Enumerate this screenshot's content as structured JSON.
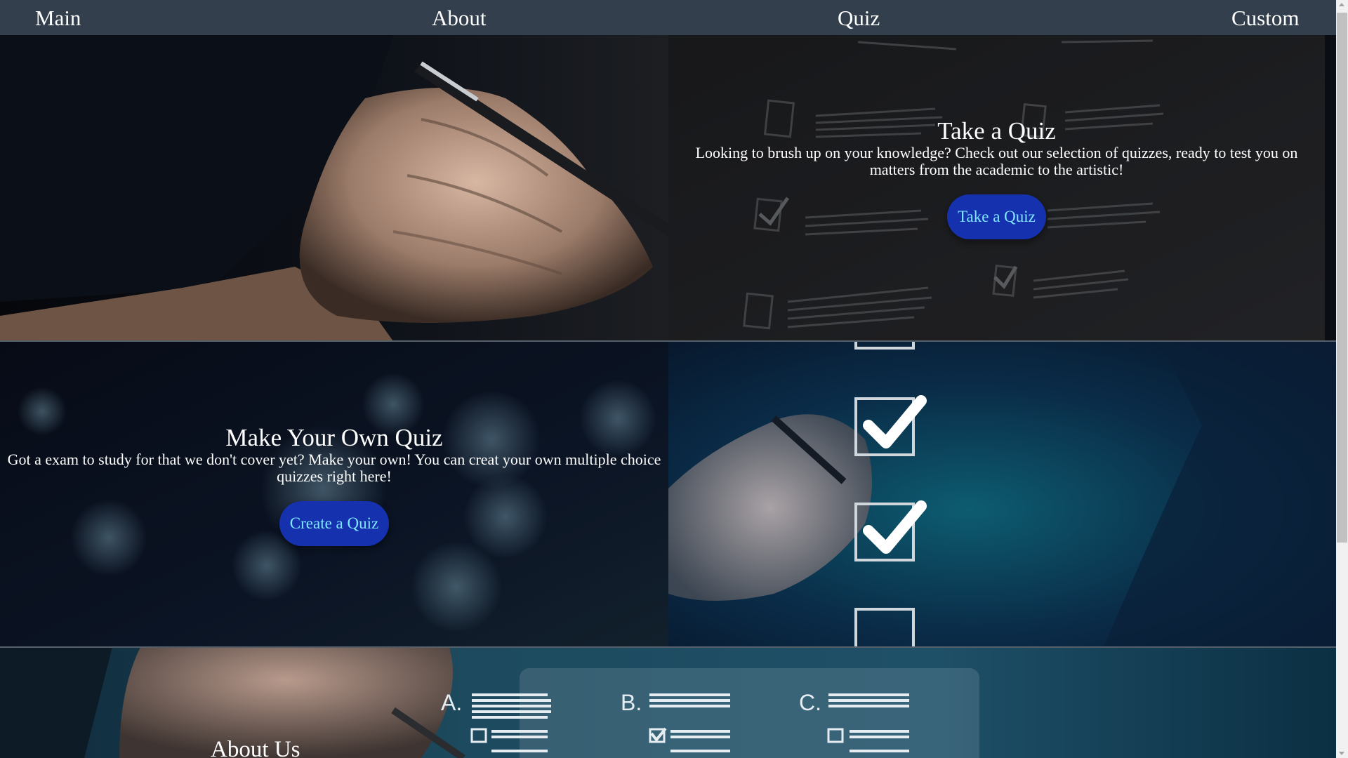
{
  "nav": {
    "main_label": "Main",
    "about_label": "About",
    "quiz_label": "Quiz",
    "custom_label": "Custom"
  },
  "take_quiz": {
    "heading": "Take a Quiz",
    "description": "Looking to brush up on your knowledge? Check out our selection of quizzes, ready to test you on matters from the academic to the artistic!",
    "button_label": "Take a Quiz"
  },
  "make_quiz": {
    "heading": "Make Your Own Quiz",
    "description": "Got a exam to study for that we don't cover yet? Make your own! You can creat your own multiple choice quizzes right here!",
    "button_label": "Create a Quiz"
  },
  "about": {
    "heading": "About Us",
    "option_labels": [
      "A.",
      "B.",
      "C."
    ]
  },
  "colors": {
    "navbar": "#333f4d",
    "button_bg": "#1531ad",
    "button_text": "#7fe8ff",
    "text": "#ffffff"
  }
}
